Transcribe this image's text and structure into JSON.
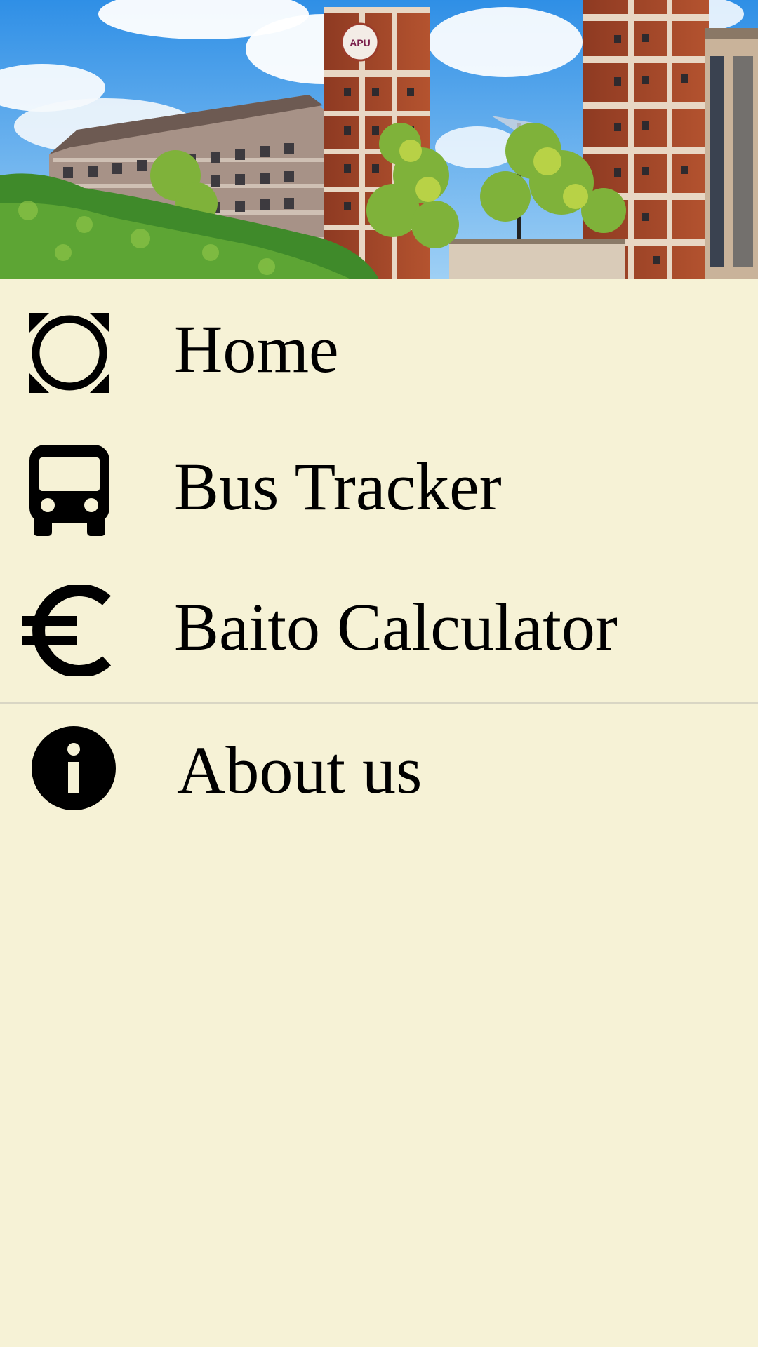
{
  "header": {
    "image": "campus-photo",
    "tower_emblem": "APU"
  },
  "menu": {
    "items": [
      {
        "label": "Home",
        "icon": "home-target-icon"
      },
      {
        "label": "Bus Tracker",
        "icon": "bus-icon"
      },
      {
        "label": "Baito Calculator",
        "icon": "euro-icon"
      }
    ],
    "secondary": [
      {
        "label": "About us",
        "icon": "info-icon"
      }
    ]
  },
  "colors": {
    "background": "#f6f2d6",
    "divider": "#d9d6c4",
    "text": "#000000"
  }
}
